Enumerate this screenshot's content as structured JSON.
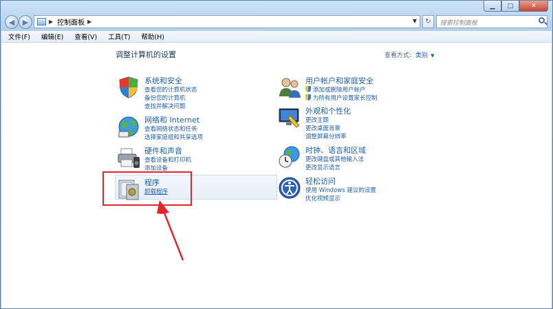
{
  "address": {
    "crumb": "控制面板"
  },
  "search": {
    "placeholder": "搜索控制面板"
  },
  "menu": [
    "文件(F)",
    "编辑(E)",
    "查看(V)",
    "工具(T)",
    "帮助(H)"
  ],
  "page": {
    "title": "调整计算机的设置",
    "viewby_label": "查看方式:",
    "viewby_value": "类别"
  },
  "left": [
    {
      "title": "系统和安全",
      "links": [
        "查看您的计算机状态",
        "备份您的计算机",
        "查找并解决问题"
      ]
    },
    {
      "title": "网络和 Internet",
      "links": [
        "查看网络状态和任务",
        "选择家庭组和共享选项"
      ]
    },
    {
      "title": "硬件和声音",
      "links": [
        "查看设备和打印机",
        "添加设备"
      ]
    },
    {
      "title": "程序",
      "links": [
        "卸载程序"
      ]
    }
  ],
  "right": [
    {
      "title": "用户帐户和家庭安全",
      "links": [
        "添加或删除用户帐户",
        "为所有用户设置家长控制"
      ]
    },
    {
      "title": "外观和个性化",
      "links": [
        "更改主题",
        "更改桌面背景",
        "调整屏幕分辨率"
      ]
    },
    {
      "title": "时钟、语言和区域",
      "links": [
        "更改键盘或其他输入法",
        "更改显示语言"
      ]
    },
    {
      "title": "轻松访问",
      "links": [
        "使用 Windows 建议的设置",
        "优化视频显示"
      ]
    }
  ],
  "colors": {
    "accent": "#1f5fb3",
    "highlight": "#e0262b"
  }
}
